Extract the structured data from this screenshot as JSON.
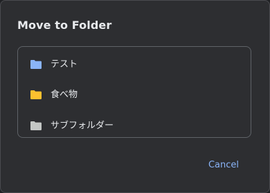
{
  "dialog": {
    "title": "Move to Folder",
    "folders": [
      {
        "label": "テスト",
        "icon": "folder-icon",
        "color": "#8ab4f8"
      },
      {
        "label": "食べ物",
        "icon": "folder-icon",
        "color": "#fdc02f"
      },
      {
        "label": "サブフォルダー",
        "icon": "folder-icon",
        "color": "#c4c7c5"
      }
    ],
    "cancel_label": "Cancel"
  },
  "colors": {
    "background": "#2d2e31",
    "border": "#5f6368",
    "text": "#e8eaed",
    "accent": "#8ab4f8"
  }
}
